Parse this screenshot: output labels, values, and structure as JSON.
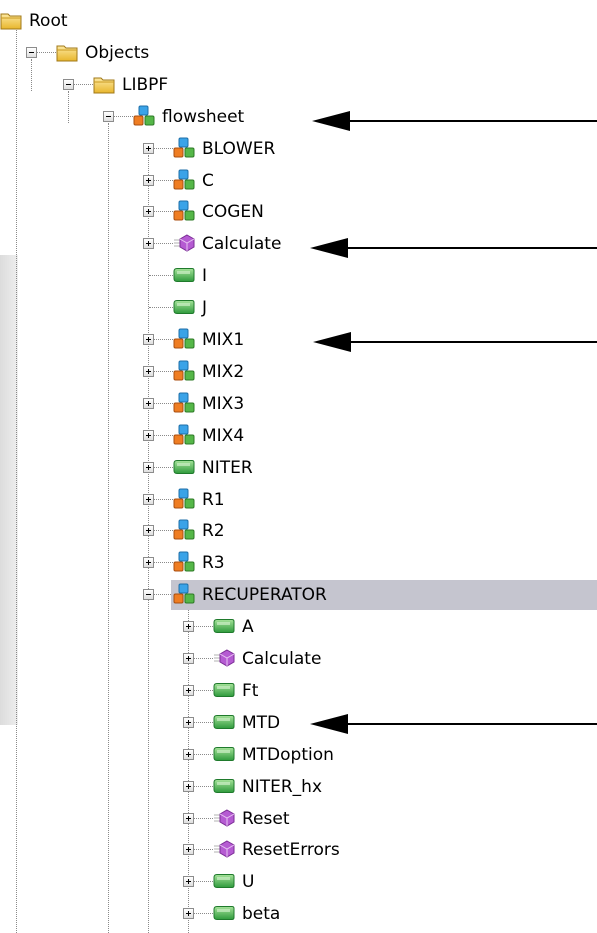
{
  "colors": {
    "selection": "#c5c5cf",
    "folder": "#f2c84b",
    "object_blue": "#3aa3e8",
    "object_orange": "#ef7d22",
    "object_green": "#55b748",
    "variable_green": "#3db34a",
    "method_purple": "#b55bd2"
  },
  "tree": {
    "root": {
      "label": "Root",
      "icon": "folder-icon"
    },
    "objects": {
      "label": "Objects",
      "icon": "folder-icon"
    },
    "libpf": {
      "label": "LIBPF",
      "icon": "folder-icon"
    },
    "flowsheet": {
      "label": "flowsheet",
      "icon": "object-cubes-icon"
    },
    "flowsheet_children": [
      {
        "label": "BLOWER",
        "icon": "object-cubes-icon"
      },
      {
        "label": "C",
        "icon": "object-cubes-icon"
      },
      {
        "label": "COGEN",
        "icon": "object-cubes-icon"
      },
      {
        "label": "Calculate",
        "icon": "method-icon"
      },
      {
        "label": "I",
        "icon": "variable-tag-icon"
      },
      {
        "label": "J",
        "icon": "variable-tag-icon"
      },
      {
        "label": "MIX1",
        "icon": "object-cubes-icon"
      },
      {
        "label": "MIX2",
        "icon": "object-cubes-icon"
      },
      {
        "label": "MIX3",
        "icon": "object-cubes-icon"
      },
      {
        "label": "MIX4",
        "icon": "object-cubes-icon"
      },
      {
        "label": "NITER",
        "icon": "variable-tag-icon"
      },
      {
        "label": "R1",
        "icon": "object-cubes-icon"
      },
      {
        "label": "R2",
        "icon": "object-cubes-icon"
      },
      {
        "label": "R3",
        "icon": "object-cubes-icon"
      },
      {
        "label": "RECUPERATOR",
        "icon": "object-cubes-icon"
      }
    ],
    "recuperator_children": [
      {
        "label": "A",
        "icon": "variable-tag-icon"
      },
      {
        "label": "Calculate",
        "icon": "method-icon"
      },
      {
        "label": "Ft",
        "icon": "variable-tag-icon"
      },
      {
        "label": "MTD",
        "icon": "variable-tag-icon"
      },
      {
        "label": "MTDoption",
        "icon": "variable-tag-icon"
      },
      {
        "label": "NITER_hx",
        "icon": "variable-tag-icon"
      },
      {
        "label": "Reset",
        "icon": "method-icon"
      },
      {
        "label": "ResetErrors",
        "icon": "method-icon"
      },
      {
        "label": "U",
        "icon": "variable-tag-icon"
      },
      {
        "label": "beta",
        "icon": "variable-tag-icon"
      }
    ]
  }
}
